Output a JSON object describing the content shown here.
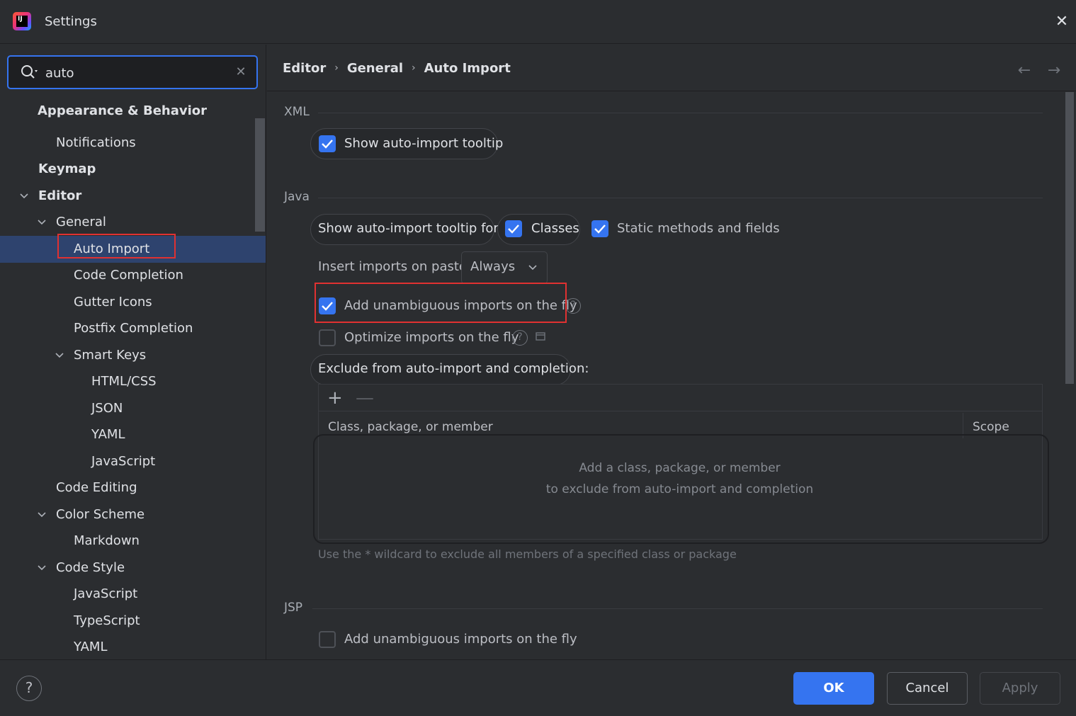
{
  "window": {
    "title": "Settings",
    "close_glyph": "✕",
    "logo_icon": "intellij-idea-logo"
  },
  "search": {
    "value": "auto",
    "clear_glyph": "✕"
  },
  "tree": {
    "items": [
      {
        "label": "Appearance & Behavior"
      },
      {
        "label": "Notifications"
      },
      {
        "label": "Keymap"
      },
      {
        "label": "Editor"
      },
      {
        "label": "General"
      },
      {
        "label": "Auto Import"
      },
      {
        "label": "Code Completion"
      },
      {
        "label": "Gutter Icons"
      },
      {
        "label": "Postfix Completion"
      },
      {
        "label": "Smart Keys"
      },
      {
        "label": "HTML/CSS"
      },
      {
        "label": "JSON"
      },
      {
        "label": "YAML"
      },
      {
        "label": "JavaScript"
      },
      {
        "label": "Code Editing"
      },
      {
        "label": "Color Scheme"
      },
      {
        "label": "Markdown"
      },
      {
        "label": "Code Style"
      },
      {
        "label": "JavaScript"
      },
      {
        "label": "TypeScript"
      },
      {
        "label": "YAML"
      }
    ]
  },
  "breadcrumb": {
    "items": [
      "Editor",
      "General",
      "Auto Import"
    ],
    "back_glyph": "←",
    "forward_glyph": "→"
  },
  "xml": {
    "section": "XML",
    "show_tooltip": "Show auto-import tooltip"
  },
  "java": {
    "section": "Java",
    "tooltip_for": "Show auto-import tooltip for:",
    "classes": "Classes",
    "static_methods": "Static methods and fields",
    "insert_on_paste": "Insert imports on paste:",
    "insert_on_paste_value": "Always",
    "add_unambiguous": "Add unambiguous imports on the fly",
    "optimize": "Optimize imports on the fly",
    "exclude_label": "Exclude from auto-import and completion:",
    "table": {
      "add_glyph": "+",
      "remove_glyph": "—",
      "col_a": "Class, package, or member",
      "col_b": "Scope",
      "empty_line1": "Add a class, package, or member",
      "empty_line2": "to exclude from auto-import and completion"
    },
    "hint": "Use the * wildcard to exclude all members of a specified class or package"
  },
  "jsp": {
    "section": "JSP",
    "add_unambiguous": "Add unambiguous imports on the fly"
  },
  "help_glyph": "?",
  "buttons": {
    "ok": "OK",
    "cancel": "Cancel",
    "apply": "Apply"
  },
  "colors": {
    "accent": "#3574f0",
    "highlight": "#e03131",
    "background": "#2b2d30"
  }
}
